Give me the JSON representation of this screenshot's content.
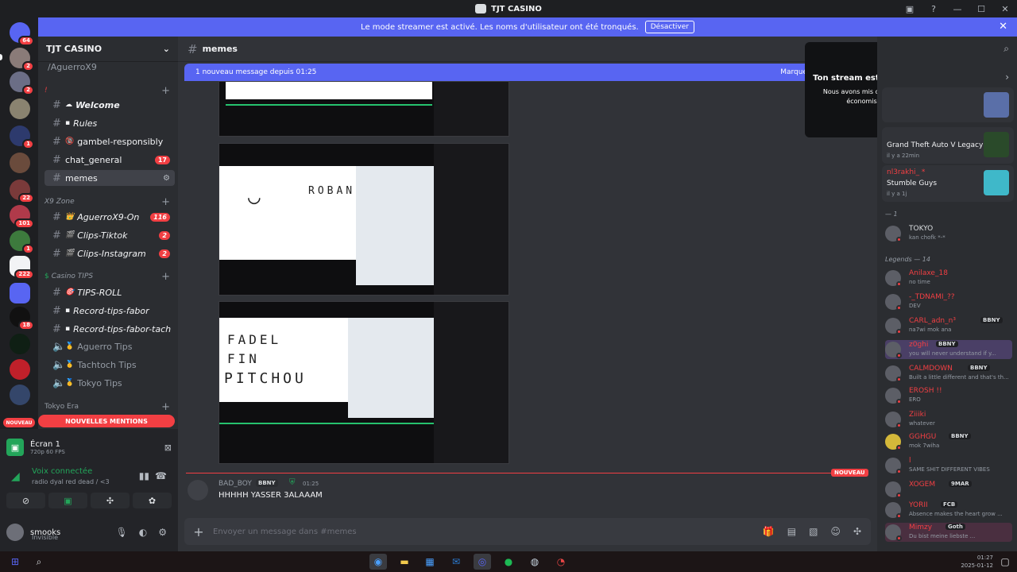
{
  "window": {
    "title": "TJT CASINO"
  },
  "banner": {
    "text": "Le mode streamer est activé. Les noms d'utilisateur ont été tronqués.",
    "button": "Désactiver"
  },
  "guild_badges": [
    "64",
    "2",
    "2",
    "1",
    "22",
    "101",
    "1",
    "222",
    "18"
  ],
  "guild_label_new": "NOUVEAU",
  "server": {
    "name": "TJT CASINO"
  },
  "channels": [
    {
      "name": "/AguerroX9"
    },
    {
      "name": "Welcome",
      "emoji": "☁"
    },
    {
      "name": "Rules",
      "emoji": "▪"
    },
    {
      "name": "gambel-responsibly",
      "emoji": "🔞"
    },
    {
      "name": "chat_general",
      "badge": "17"
    },
    {
      "name": "memes"
    },
    {
      "name": "AguerroX9-On",
      "emoji": "👑",
      "badge": "116"
    },
    {
      "name": "Clips-Tiktok",
      "emoji": "🎬",
      "badge": "2"
    },
    {
      "name": "Clips-Instagram",
      "emoji": "🎬",
      "badge": "2"
    },
    {
      "name": "TIPS-ROLL",
      "emoji": "🎯"
    },
    {
      "name": "Record-tips-fabor",
      "emoji": "▪"
    },
    {
      "name": "Record-tips-fabor-tach",
      "emoji": "▪"
    },
    {
      "name": "Aguerro Tips",
      "emoji": "🥇"
    },
    {
      "name": "Tachtoch Tips",
      "emoji": "🥇"
    },
    {
      "name": "Tokyo Tips",
      "emoji": "🥇"
    }
  ],
  "categories": [
    "X9 Zone",
    "Casino TIPS",
    "Tokyo Era"
  ],
  "mentions_bar": "NOUVELLES MENTIONS",
  "stream": {
    "title": "Écran 1",
    "quality": "720p 60 FPS"
  },
  "voice": {
    "status": "Voix connectée",
    "channel": "radio dyal red dead / <3"
  },
  "user": {
    "name": "smooks",
    "status": "Invisible"
  },
  "chat_header": {
    "channel": "memes"
  },
  "new_messages": {
    "text": "1 nouveau message depuis 01:25",
    "mark": "Marque"
  },
  "drawings": {
    "one": "ROBAN",
    "two_l1": "FADEL",
    "two_l2": "FIN",
    "two_l3": "PITCHOU"
  },
  "message": {
    "author": "BAD_BOY",
    "badge": "BBNY",
    "time": "01:25",
    "text": "HHHHH YASSER 3ALAAAM"
  },
  "new_tag": "NOUVEAU",
  "composer": {
    "placeholder": "Envoyer un message dans #memes"
  },
  "overlay": {
    "title": "Ton stream est toujours en cours !",
    "subtitle": "Nous avons mis cet aperçu en pause pour économiser tes ressources."
  },
  "activities": [
    {
      "game": "Grand Theft Auto V Legacy",
      "time": "il y a 22min"
    },
    {
      "user": "nl3rakhi_ *",
      "game": "Stumble Guys",
      "time": "il y a 1j"
    }
  ],
  "groups": {
    "g1": "— 1",
    "g2": "Legends — 14"
  },
  "members": [
    {
      "name": "TOKYO",
      "status": "kan chofk *-*"
    },
    {
      "name": "Anilaxe_18",
      "status": "no time"
    },
    {
      "name": "-_TDNAMI_??",
      "status": "DEV"
    },
    {
      "name": "CARL_adn_n³",
      "badge": "BBNY",
      "status": "na7wi mok ana"
    },
    {
      "name": "z0ghi",
      "badge": "BBNY",
      "status": "you will never understand if y..."
    },
    {
      "name": "CALMDOWN",
      "badge": "BBNY",
      "status": "Built a little different and that's th..."
    },
    {
      "name": "EROSH !!",
      "status": "ERO"
    },
    {
      "name": "Ziiiki",
      "status": "whatever"
    },
    {
      "name": "GGHGU",
      "badge": "BBNY",
      "status": "mok 7wiha"
    },
    {
      "name": "l",
      "status": "SAME SHIT DIFFERENT VIBES"
    },
    {
      "name": "XOGEM",
      "badge": "9MAR",
      "status": ""
    },
    {
      "name": "YORII",
      "badge": "FCB",
      "status": "Absence makes the heart grow ..."
    },
    {
      "name": "Mimzy",
      "badge": "Goth",
      "status": "Du bist meine liebste ..."
    }
  ],
  "clock": {
    "time": "01:27",
    "date": "2025-01-12"
  }
}
